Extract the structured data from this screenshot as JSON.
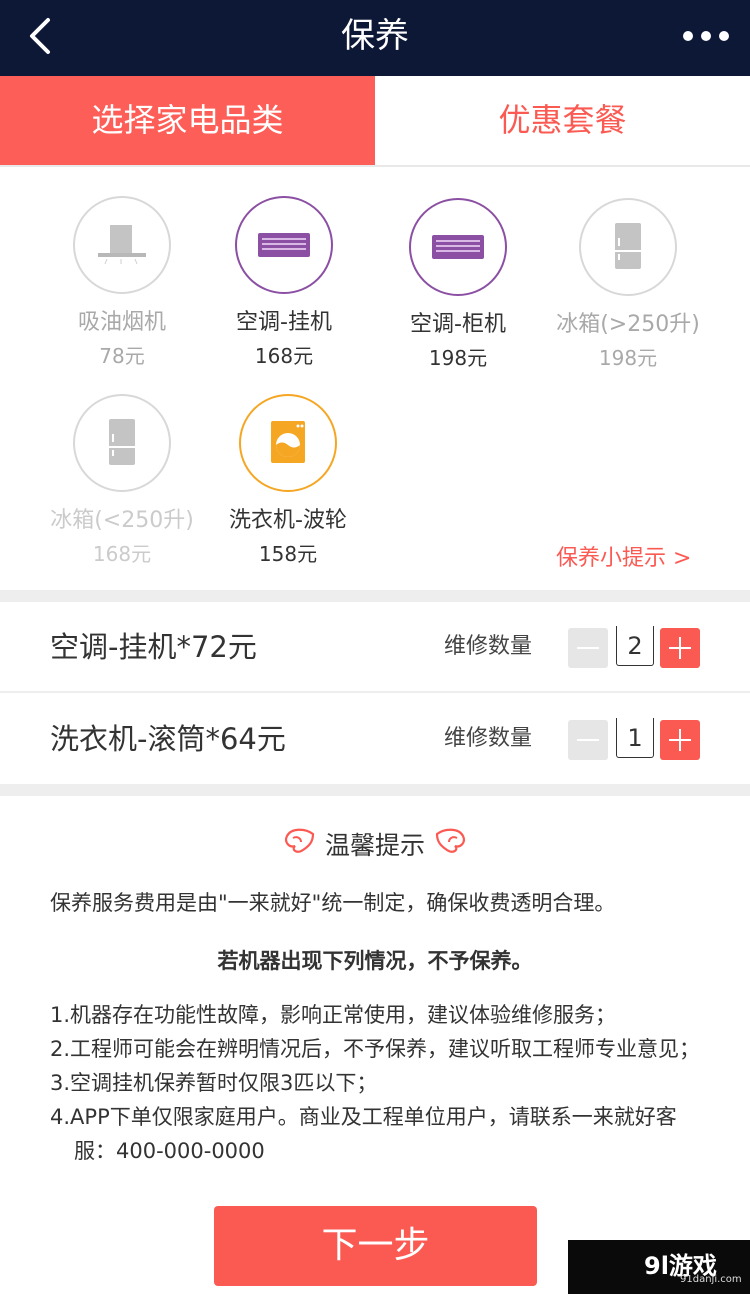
{
  "header": {
    "title": "保养"
  },
  "tabs": [
    {
      "label": "选择家电品类"
    },
    {
      "label": "优惠套餐"
    }
  ],
  "appliances": [
    {
      "name": "吸油烟机",
      "price": "78元",
      "icon": "range-hood-icon"
    },
    {
      "name": "空调-挂机",
      "price": "168元",
      "icon": "wall-ac-icon"
    },
    {
      "name": "空调-柜机",
      "price": "198元",
      "icon": "cabinet-ac-icon"
    },
    {
      "name": "冰箱(>250升)",
      "price": "198元",
      "icon": "fridge-icon"
    },
    {
      "name": "冰箱(<250升)",
      "price": "168元",
      "icon": "fridge-icon"
    },
    {
      "name": "洗衣机-波轮",
      "price": "158元",
      "icon": "washing-machine-icon"
    }
  ],
  "tip_link": {
    "label": "保养小提示 >"
  },
  "orders": [
    {
      "name": "空调-挂机*72元",
      "qty_label": "维修数量",
      "qty": "2"
    },
    {
      "name": "洗衣机-滚筒*64元",
      "qty_label": "维修数量",
      "qty": "1"
    }
  ],
  "notice": {
    "title": "温馨提示",
    "intro": "保养服务费用是由\"一来就好\"统一制定，确保收费透明合理。",
    "warning": "若机器出现下列情况，不予保养。",
    "items": [
      "1.机器存在功能性故障，影响正常使用，建议体验维修服务；",
      "2.工程师可能会在辨明情况后，不予保养，建议听取工程师专业意见；",
      "3.空调挂机保养暂时仅限3匹以下；",
      "4.APP下单仅限家庭用户。商业及工程单位用户，请联系一来就好客服：400-000-0000"
    ]
  },
  "next_button": {
    "label": "下一步"
  },
  "watermark": {
    "logo": "9l游戏",
    "site": "91danji.com"
  },
  "colors": {
    "accent": "#fb5a53",
    "header_bg": "#0d1836",
    "purple": "#8b4fa3",
    "orange": "#f5a623"
  }
}
